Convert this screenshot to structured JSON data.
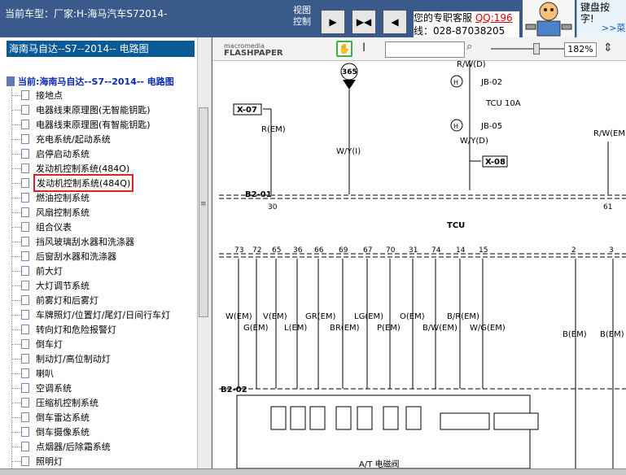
{
  "top": {
    "car_model": "当前车型：厂家:H-海马汽车S72014-",
    "view_control_1": "视图",
    "view_control_2": "控制",
    "kefu_text": "您的专职客服",
    "kefu_qq": "QQ:196",
    "kefu_phone": "线：028-87038205",
    "keyboard_line1": "键盘按",
    "keyboard_line2": "字!",
    "keyboard_link": ">>菜"
  },
  "left": {
    "header": "海南马自达--S7--2014-- 电路图",
    "root": "当前:海南马自达--S7--2014-- 电路图",
    "items": [
      "接地点",
      "电器线束原理图(无智能钥匙)",
      "电器线束原理图(有智能钥匙)",
      "充电系统/起动系统",
      "启停启动系统",
      "发动机控制系统(484O)",
      "发动机控制系统(484Q)",
      "燃油控制系统",
      "风扇控制系统",
      "组合仪表",
      "挡风玻璃刮水器和洗涤器",
      "后窗刮水器和洗涤器",
      "前大灯",
      "大灯调节系统",
      "前雾灯和后雾灯",
      "车牌照灯/位置灯/尾灯/日间行车灯",
      "转向灯和危险报警灯",
      "倒车灯",
      "制动灯/高位制动灯",
      "喇叭",
      "空调系统",
      "压缩机控制系统",
      "倒车雷达系统",
      "倒车摄像系统",
      "点烟器/后除霜系统",
      "照明灯"
    ]
  },
  "viewer": {
    "logo_top": "macromedia",
    "logo_bottom": "FLASHPAPER",
    "zoom": "182%"
  },
  "diagram": {
    "connector_365": "365",
    "x07": "X-07",
    "x08": "X-08",
    "rw_d": "R/W(D)",
    "jb02": "JB-02",
    "tcu10a": "TCU 10A",
    "jb05": "JB-05",
    "wy_d": "W/Y(D)",
    "r_em": "R(EM)",
    "wy_i": "W/Y(I)",
    "rw_em": "R/W(EM)",
    "b201": "B2-01",
    "pin30": "30",
    "pin61": "61",
    "tcu": "TCU",
    "b202": "B2-02",
    "pins": [
      "73",
      "72",
      "65",
      "36",
      "66",
      "69",
      "67",
      "70",
      "31",
      "74",
      "14",
      "15",
      "2",
      "3"
    ],
    "wires": [
      "W(EM)",
      "G(EM)",
      "V(EM)",
      "L(EM)",
      "GR(EM)",
      "BR(EM)",
      "LG(EM)",
      "P(EM)",
      "O(EM)",
      "B/W(EM)",
      "B/R(EM)",
      "W/G(EM)",
      "B(EM)",
      "B(EM)"
    ],
    "at_label": "A/T 电磁阀",
    "h": "H"
  }
}
